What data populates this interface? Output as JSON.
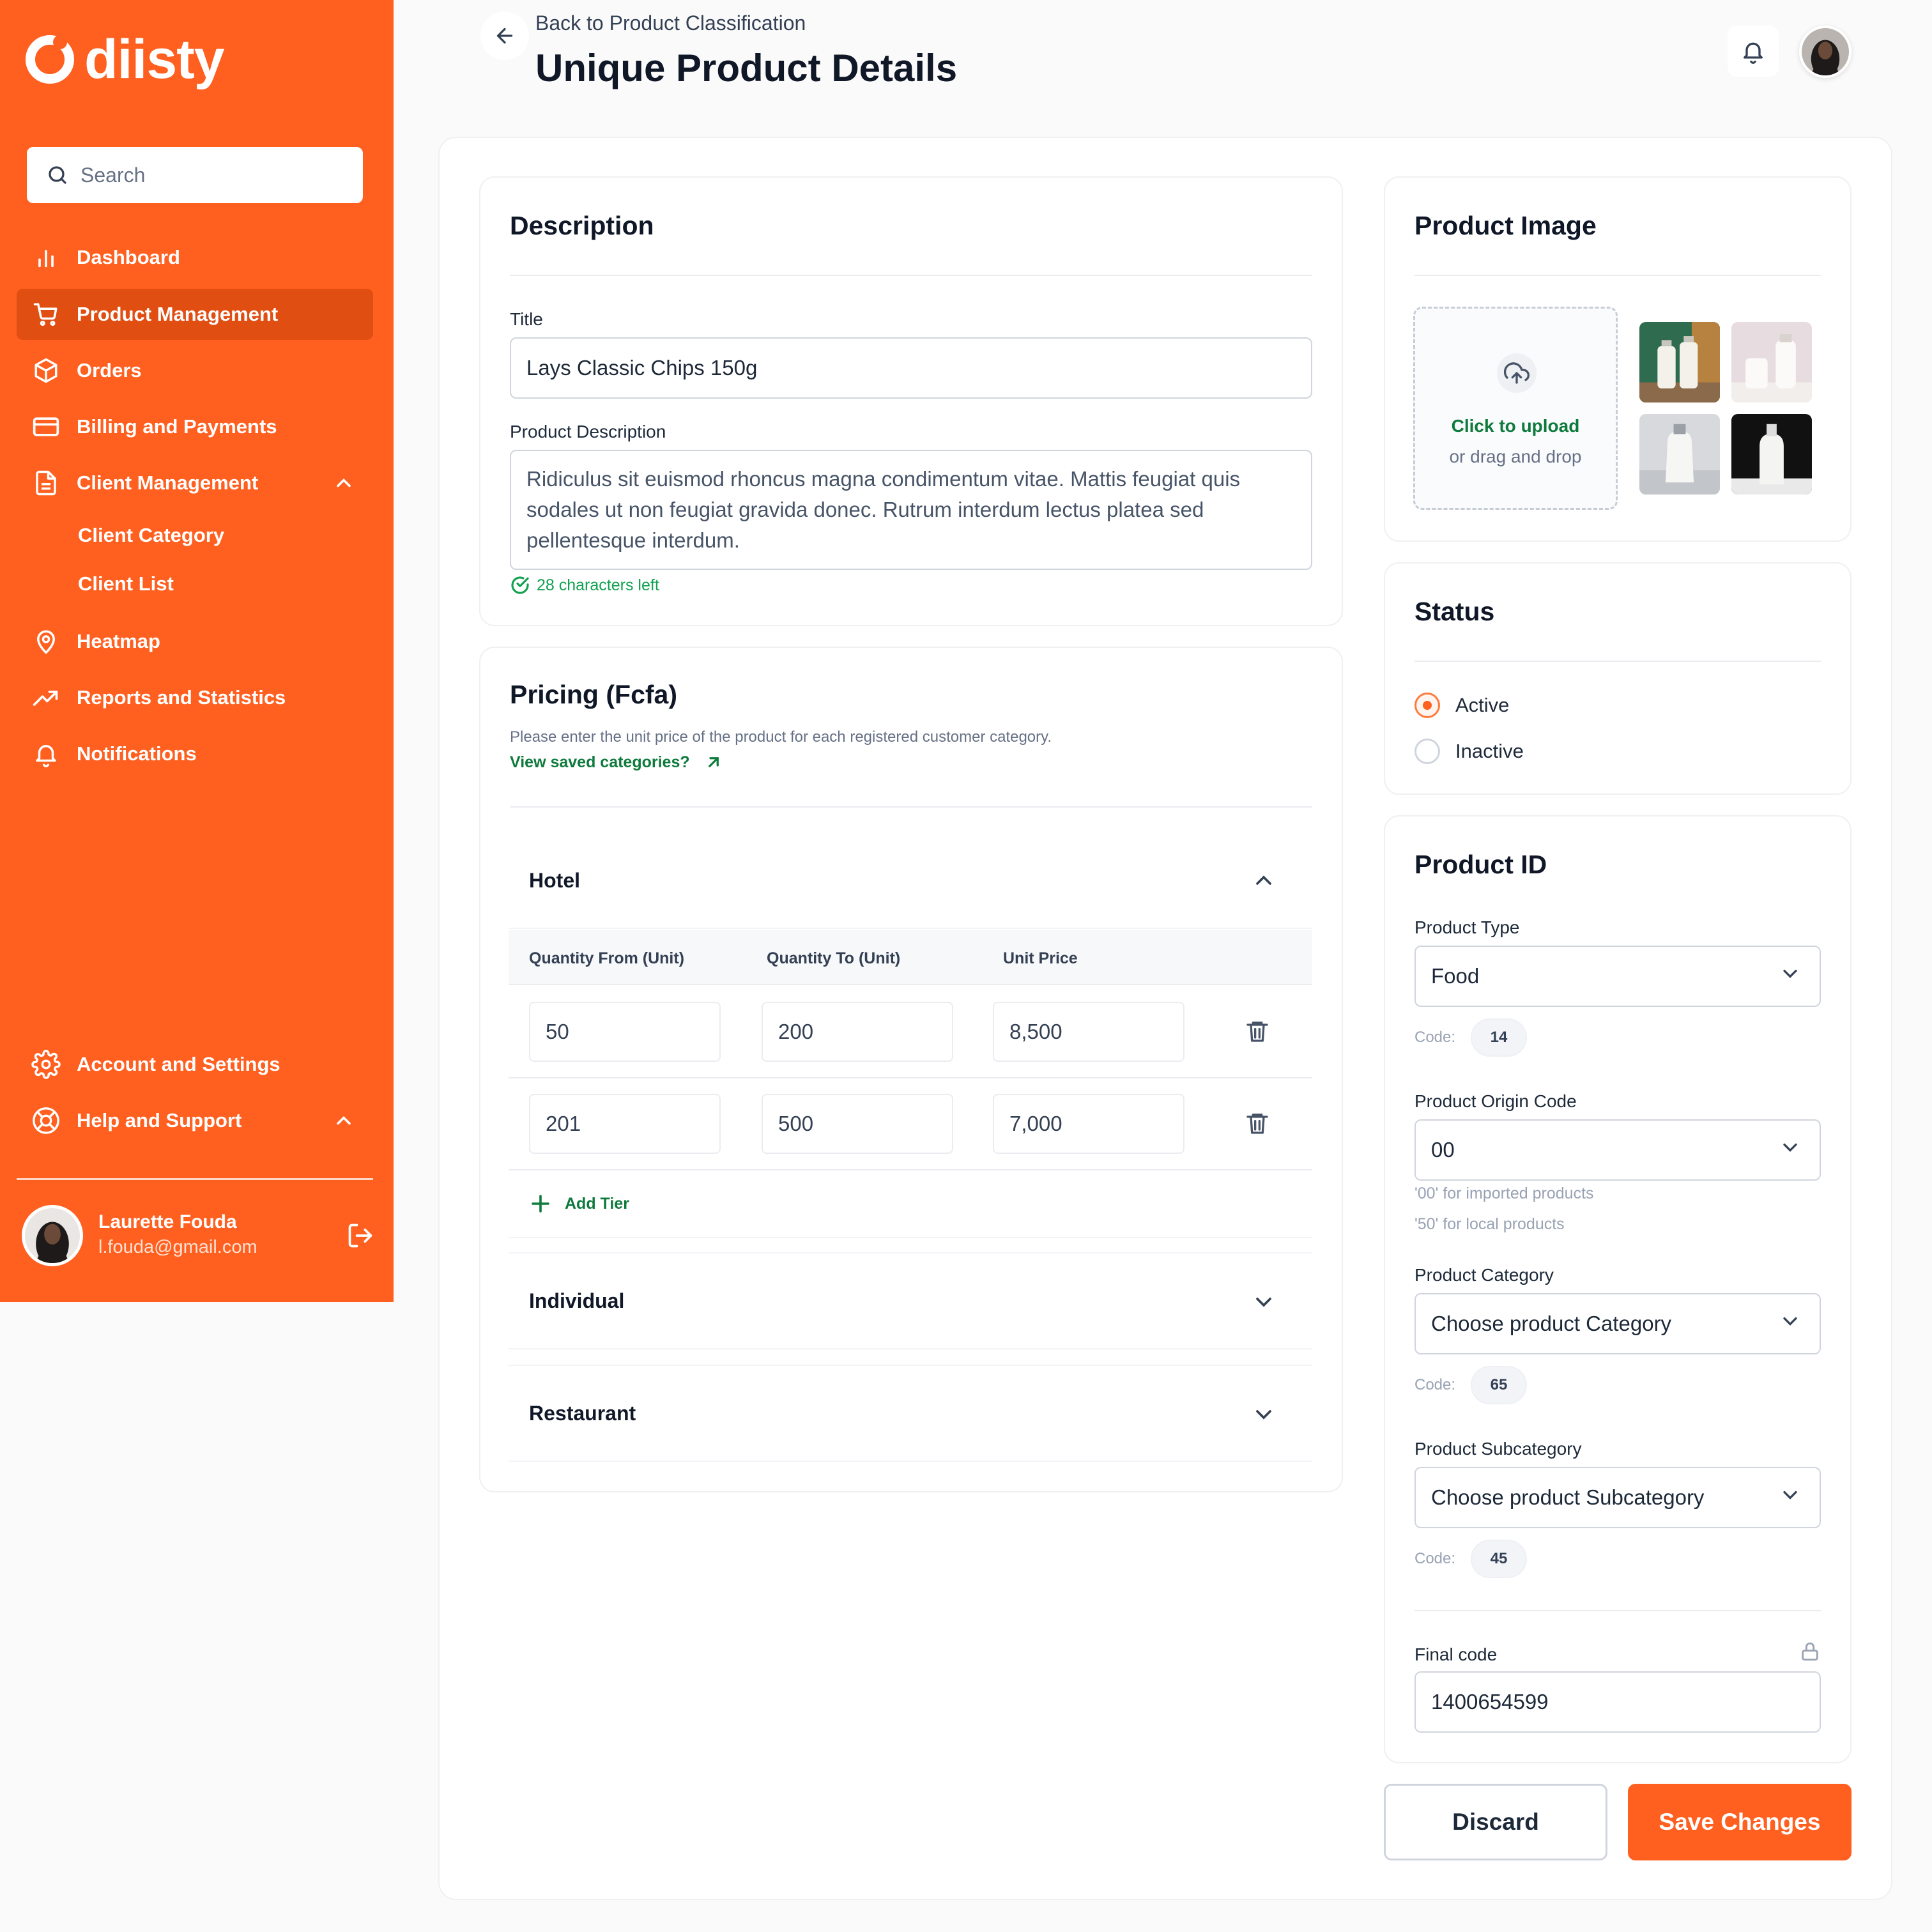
{
  "brand": {
    "name": "diisty",
    "accent": "#ff5f1f",
    "link_green": "#0e7a3c"
  },
  "sidebar": {
    "search_placeholder": "Search",
    "items": [
      {
        "label": "Dashboard",
        "icon": "bar-chart-icon"
      },
      {
        "label": "Product Management",
        "icon": "cart-icon",
        "active": true
      },
      {
        "label": "Orders",
        "icon": "box-icon"
      },
      {
        "label": "Billing and Payments",
        "icon": "card-icon"
      },
      {
        "label": "Client Management",
        "icon": "document-icon",
        "expanded": true
      },
      {
        "label": "Heatmap",
        "icon": "map-pin-icon"
      },
      {
        "label": "Reports and Statistics",
        "icon": "trend-icon"
      },
      {
        "label": "Notifications",
        "icon": "bell-icon"
      }
    ],
    "sub_items": [
      "Client Category",
      "Client List"
    ],
    "footer_items": [
      {
        "label": "Account and Settings",
        "icon": "gear-icon"
      },
      {
        "label": "Help and Support",
        "icon": "lifebuoy-icon"
      }
    ],
    "user": {
      "name": "Laurette Fouda",
      "email": "l.fouda@gmail.com"
    }
  },
  "header": {
    "breadcrumb": "Back to Product Classification",
    "title": "Unique Product Details"
  },
  "description": {
    "heading": "Description",
    "title_label": "Title",
    "title_value": "Lays Classic Chips 150g",
    "desc_label": "Product Description",
    "desc_value": "Ridiculus sit euismod rhoncus magna condimentum vitae. Mattis feugiat quis sodales ut non feugiat gravida donec. Rutrum interdum lectus platea sed pellentesque interdum.",
    "chars_left": "28 characters left"
  },
  "pricing": {
    "heading": "Pricing (Fcfa)",
    "subtitle": "Please enter the unit price of the product for each registered customer category.",
    "link": "View saved categories?",
    "columns": [
      "Quantity From (Unit)",
      "Quantity To (Unit)",
      "Unit Price"
    ],
    "groups": [
      {
        "name": "Hotel",
        "expanded": true,
        "tiers": [
          {
            "from": "50",
            "to": "200",
            "price": "8,500"
          },
          {
            "from": "201",
            "to": "500",
            "price": "7,000"
          }
        ],
        "add_label": "Add Tier"
      },
      {
        "name": "Individual",
        "expanded": false
      },
      {
        "name": "Restaurant",
        "expanded": false
      }
    ]
  },
  "product_image": {
    "heading": "Product Image",
    "upload_cta": "Click to upload",
    "upload_hint": "or drag and drop"
  },
  "status": {
    "heading": "Status",
    "options": [
      "Active",
      "Inactive"
    ],
    "selected": "Active"
  },
  "product_id": {
    "heading": "Product ID",
    "code_label": "Code:",
    "type_label": "Product Type",
    "type_value": "Food",
    "type_code": "14",
    "origin_label": "Product Origin Code",
    "origin_value": "00",
    "origin_hint_1": "'00' for imported products",
    "origin_hint_2": "'50' for local products",
    "category_label": "Product Category",
    "category_placeholder": "Choose product Category",
    "category_code": "65",
    "subcategory_label": "Product Subcategory",
    "subcategory_placeholder": "Choose product Subcategory",
    "subcategory_code": "45",
    "final_label": "Final code",
    "final_value": "1400654599"
  },
  "actions": {
    "discard": "Discard",
    "save": "Save Changes"
  }
}
